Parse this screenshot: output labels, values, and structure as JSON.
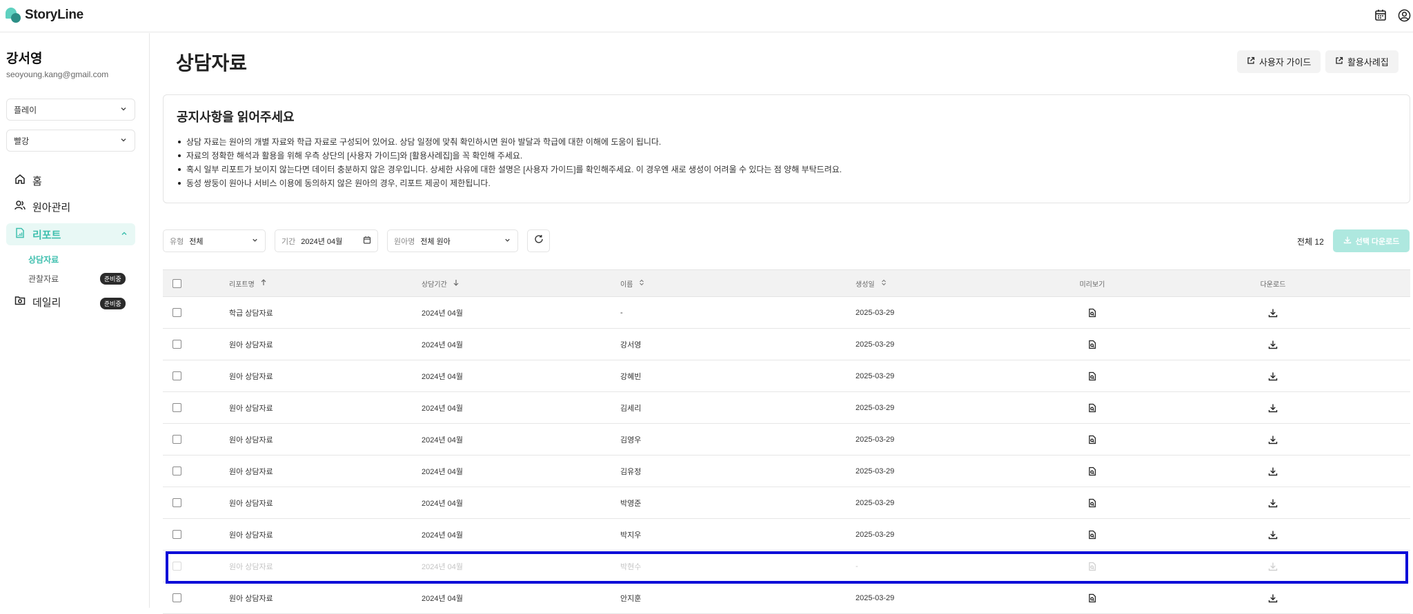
{
  "app": {
    "name": "StoryLine"
  },
  "topbar": {
    "icons": [
      "calendar-icon",
      "user-circle-icon"
    ]
  },
  "sidebar": {
    "user_name": "강서영",
    "user_email": "seoyoung.kang@gmail.com",
    "select1": "플레이",
    "select2": "빨강",
    "nav": {
      "home": "홈",
      "child_mgmt": "원아관리",
      "report": "리포트",
      "sub_counseling": "상담자료",
      "sub_observation": "관찰자료",
      "badge_preparing": "준비중",
      "daily": "데일리",
      "daily_badge": "준비중"
    }
  },
  "main": {
    "title": "상담자료",
    "user_guide_label": "사용자 가이드",
    "cases_label": "활용사례집",
    "notice": {
      "title": "공지사항을 읽어주세요",
      "items": [
        "상담 자료는 원아의 개별 자료와 학급 자료로 구성되어 있어요. 상담 일정에 맞춰 확인하시면 원아 발달과 학급에 대한 이해에 도움이 됩니다.",
        "자료의 정확한 해석과 활용을 위해 우측 상단의 [사용자 가이드]와 [활용사례집]을 꼭 확인해 주세요.",
        "혹시 일부 리포트가 보이지 않는다면 데이터 충분하지 않은 경우입니다. 상세한 사유에 대한 설명은 [사용자 가이드]를 확인해주세요. 이 경우엔 새로 생성이 어려울 수 있다는 점 양해 부탁드려요.",
        "동성 쌍둥이 원아나 서비스 이용에 동의하지 않은 원아의 경우, 리포트 제공이 제한됩니다."
      ]
    },
    "filters": {
      "type_label": "유형",
      "type_value": "전체",
      "period_label": "기간",
      "period_value": "2024년 04월",
      "child_label": "원아명",
      "child_value": "전체 원아"
    },
    "total_label": "전체 12",
    "download_selected_label": "선택 다운로드",
    "table": {
      "headers": {
        "report": "리포트명",
        "period": "상담기간",
        "name": "이름",
        "created": "생성일",
        "preview": "미리보기",
        "download": "다운로드"
      },
      "rows": [
        {
          "report": "학급 상담자료",
          "period": "2024년 04월",
          "name": "-",
          "created": "2025-03-29",
          "disabled": false
        },
        {
          "report": "원아 상담자료",
          "period": "2024년 04월",
          "name": "강서영",
          "created": "2025-03-29",
          "disabled": false
        },
        {
          "report": "원아 상담자료",
          "period": "2024년 04월",
          "name": "강혜빈",
          "created": "2025-03-29",
          "disabled": false
        },
        {
          "report": "원아 상담자료",
          "period": "2024년 04월",
          "name": "김세리",
          "created": "2025-03-29",
          "disabled": false
        },
        {
          "report": "원아 상담자료",
          "period": "2024년 04월",
          "name": "김영우",
          "created": "2025-03-29",
          "disabled": false
        },
        {
          "report": "원아 상담자료",
          "period": "2024년 04월",
          "name": "김유정",
          "created": "2025-03-29",
          "disabled": false
        },
        {
          "report": "원아 상담자료",
          "period": "2024년 04월",
          "name": "박영준",
          "created": "2025-03-29",
          "disabled": false
        },
        {
          "report": "원아 상담자료",
          "period": "2024년 04월",
          "name": "박지우",
          "created": "2025-03-29",
          "disabled": false
        },
        {
          "report": "원아 상담자료",
          "period": "2024년 04월",
          "name": "박현수",
          "created": "-",
          "disabled": true
        },
        {
          "report": "원아 상담자료",
          "period": "2024년 04월",
          "name": "안지훈",
          "created": "2025-03-29",
          "disabled": false
        }
      ]
    }
  },
  "colors": {
    "accent": "#3ebfae",
    "accent_light": "#e8f8f5",
    "highlight": "#0a0ad8"
  }
}
